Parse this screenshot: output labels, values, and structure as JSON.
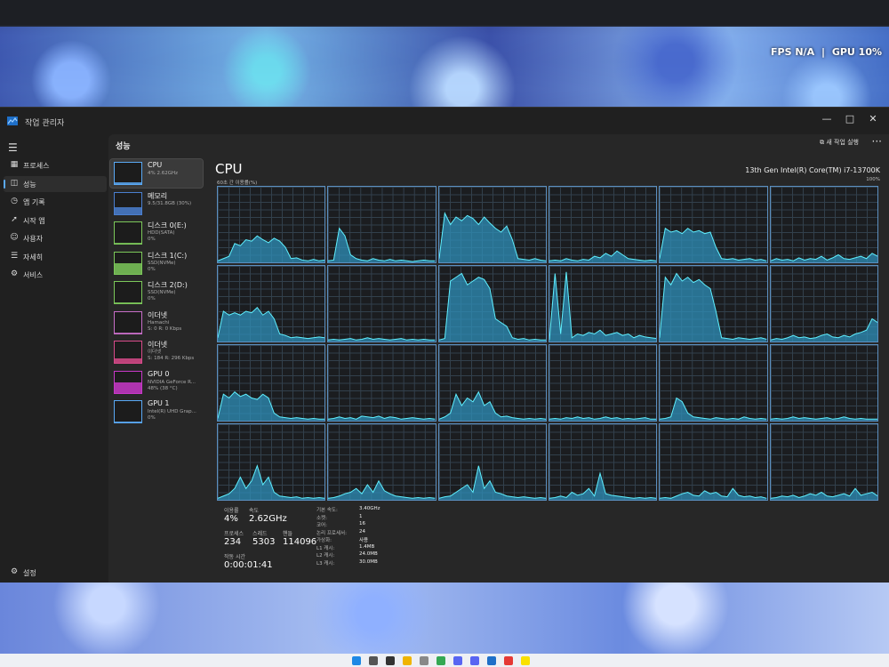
{
  "overlay": {
    "fps": "FPS N/A",
    "sep": "|",
    "gpu": "GPU 10%"
  },
  "window": {
    "title": "작업 관리자",
    "minimize": "—",
    "maximize": "□",
    "close": "✕"
  },
  "sidebar": {
    "items": [
      {
        "icon": "processes-icon",
        "glyph": "▦",
        "label": "프로세스",
        "active": false
      },
      {
        "icon": "performance-icon",
        "glyph": "◫",
        "label": "성능",
        "active": true
      },
      {
        "icon": "app-history-icon",
        "glyph": "◷",
        "label": "앱 기록",
        "active": false
      },
      {
        "icon": "startup-apps-icon",
        "glyph": "➚",
        "label": "시작 앱",
        "active": false
      },
      {
        "icon": "users-icon",
        "glyph": "☺",
        "label": "사용자",
        "active": false
      },
      {
        "icon": "details-icon",
        "glyph": "☰",
        "label": "자세히",
        "active": false
      },
      {
        "icon": "services-icon",
        "glyph": "⚙",
        "label": "서비스",
        "active": false
      }
    ],
    "settings_label": "설정"
  },
  "header": {
    "title": "성능",
    "run_task": "새 작업 실행",
    "more": "···"
  },
  "devices": [
    {
      "name": "CPU",
      "sub1": "4% 2.62GHz",
      "sub2": "",
      "color": "#5aa9f5",
      "level": 0.08
    },
    {
      "name": "메모리",
      "sub1": "9.5/31.8GB (30%)",
      "sub2": "",
      "color": "#4a7fd0",
      "level": 0.3
    },
    {
      "name": "디스크 0(E:)",
      "sub1": "HDD(SATA)",
      "sub2": "0%",
      "color": "#7cc85a",
      "level": 0.0
    },
    {
      "name": "디스크 1(C:)",
      "sub1": "SSD(NVMe)",
      "sub2": "0%",
      "color": "#7cc85a",
      "level": 0.5
    },
    {
      "name": "디스크 2(D:)",
      "sub1": "SSD(NVMe)",
      "sub2": "0%",
      "color": "#7cc85a",
      "level": 0.0
    },
    {
      "name": "이더넷",
      "sub1": "Hamachi",
      "sub2": "S: 0 R: 0 Kbps",
      "color": "#c86ec8",
      "level": 0.0
    },
    {
      "name": "이더넷",
      "sub1": "이더넷",
      "sub2": "S: 184 R: 296 Kbps",
      "color": "#d84a8a",
      "level": 0.2
    },
    {
      "name": "GPU 0",
      "sub1": "NVIDIA GeForce R...",
      "sub2": "48% (38 °C)",
      "color": "#c838c8",
      "level": 0.48
    },
    {
      "name": "GPU 1",
      "sub1": "Intel(R) UHD Grap...",
      "sub2": "0%",
      "color": "#5aa9f5",
      "level": 0.0
    }
  ],
  "detail": {
    "title": "CPU",
    "model": "13th Gen Intel(R) Core(TM) i7-13700K",
    "util_label": "60초 간 이용률(%)",
    "max_label": "100%"
  },
  "stats": {
    "util_label": "이용률",
    "util_value": "4%",
    "speed_label": "속도",
    "speed_value": "2.62GHz",
    "proc_label": "프로세스",
    "proc_value": "234",
    "thread_label": "스레드",
    "thread_value": "5303",
    "handle_label": "핸들",
    "handle_value": "114096",
    "uptime_label": "작동 시간",
    "uptime_value": "0:00:01:41",
    "specs": [
      {
        "k": "기본 속도:",
        "v": "3.40GHz"
      },
      {
        "k": "소켓:",
        "v": "1"
      },
      {
        "k": "코어:",
        "v": "16"
      },
      {
        "k": "논리 프로세서:",
        "v": "24"
      },
      {
        "k": "가상화:",
        "v": "사용"
      },
      {
        "k": "L1 캐시:",
        "v": "1.4MB"
      },
      {
        "k": "L2 캐시:",
        "v": "24.0MB"
      },
      {
        "k": "L3 캐시:",
        "v": "30.0MB"
      }
    ]
  },
  "core_activity": [
    [
      0.02,
      0.05,
      0.08,
      0.25,
      0.22,
      0.3,
      0.28,
      0.35,
      0.3,
      0.26,
      0.32,
      0.28,
      0.2,
      0.05,
      0.06,
      0.03,
      0.02,
      0.04,
      0.02,
      0.03
    ],
    [
      0.02,
      0.03,
      0.45,
      0.35,
      0.1,
      0.05,
      0.03,
      0.02,
      0.05,
      0.03,
      0.02,
      0.04,
      0.02,
      0.03,
      0.02,
      0.01,
      0.02,
      0.03,
      0.02,
      0.02
    ],
    [
      0.05,
      0.65,
      0.5,
      0.6,
      0.55,
      0.62,
      0.58,
      0.5,
      0.6,
      0.52,
      0.45,
      0.4,
      0.48,
      0.3,
      0.05,
      0.04,
      0.03,
      0.05,
      0.03,
      0.02
    ],
    [
      0.02,
      0.03,
      0.02,
      0.05,
      0.03,
      0.02,
      0.04,
      0.03,
      0.08,
      0.06,
      0.12,
      0.08,
      0.15,
      0.1,
      0.05,
      0.04,
      0.03,
      0.02,
      0.03,
      0.02
    ],
    [
      0.05,
      0.45,
      0.4,
      0.42,
      0.38,
      0.45,
      0.4,
      0.42,
      0.38,
      0.4,
      0.2,
      0.05,
      0.04,
      0.05,
      0.03,
      0.04,
      0.05,
      0.03,
      0.04,
      0.02
    ],
    [
      0.02,
      0.05,
      0.03,
      0.04,
      0.02,
      0.06,
      0.03,
      0.05,
      0.04,
      0.08,
      0.03,
      0.06,
      0.1,
      0.05,
      0.04,
      0.06,
      0.08,
      0.05,
      0.12,
      0.08
    ],
    [
      0.05,
      0.4,
      0.35,
      0.38,
      0.35,
      0.4,
      0.38,
      0.45,
      0.35,
      0.4,
      0.3,
      0.1,
      0.08,
      0.05,
      0.06,
      0.05,
      0.04,
      0.05,
      0.06,
      0.05
    ],
    [
      0.02,
      0.03,
      0.02,
      0.03,
      0.04,
      0.02,
      0.03,
      0.05,
      0.03,
      0.04,
      0.03,
      0.02,
      0.03,
      0.04,
      0.02,
      0.03,
      0.02,
      0.03,
      0.02,
      0.02
    ],
    [
      0.02,
      0.04,
      0.8,
      0.85,
      0.9,
      0.75,
      0.8,
      0.85,
      0.82,
      0.7,
      0.3,
      0.25,
      0.2,
      0.05,
      0.03,
      0.04,
      0.02,
      0.03,
      0.02,
      0.02
    ],
    [
      0.02,
      0.9,
      0.1,
      0.92,
      0.05,
      0.1,
      0.08,
      0.12,
      0.1,
      0.15,
      0.08,
      0.1,
      0.12,
      0.08,
      0.1,
      0.05,
      0.08,
      0.06,
      0.05,
      0.04
    ],
    [
      0.05,
      0.85,
      0.75,
      0.9,
      0.8,
      0.85,
      0.78,
      0.82,
      0.75,
      0.7,
      0.4,
      0.05,
      0.04,
      0.03,
      0.05,
      0.04,
      0.03,
      0.04,
      0.05,
      0.03
    ],
    [
      0.02,
      0.04,
      0.03,
      0.05,
      0.08,
      0.05,
      0.06,
      0.04,
      0.05,
      0.08,
      0.1,
      0.06,
      0.05,
      0.08,
      0.06,
      0.1,
      0.12,
      0.15,
      0.3,
      0.25
    ],
    [
      0.03,
      0.35,
      0.3,
      0.38,
      0.32,
      0.35,
      0.3,
      0.28,
      0.35,
      0.3,
      0.1,
      0.05,
      0.04,
      0.03,
      0.04,
      0.03,
      0.02,
      0.03,
      0.02,
      0.02
    ],
    [
      0.02,
      0.03,
      0.05,
      0.03,
      0.04,
      0.02,
      0.06,
      0.05,
      0.04,
      0.06,
      0.03,
      0.05,
      0.04,
      0.02,
      0.03,
      0.04,
      0.03,
      0.02,
      0.03,
      0.02
    ],
    [
      0.02,
      0.05,
      0.1,
      0.35,
      0.2,
      0.3,
      0.25,
      0.38,
      0.2,
      0.25,
      0.1,
      0.05,
      0.06,
      0.04,
      0.03,
      0.02,
      0.03,
      0.02,
      0.03,
      0.02
    ],
    [
      0.02,
      0.03,
      0.02,
      0.04,
      0.03,
      0.05,
      0.03,
      0.04,
      0.02,
      0.03,
      0.05,
      0.03,
      0.04,
      0.02,
      0.03,
      0.02,
      0.03,
      0.04,
      0.02,
      0.02
    ],
    [
      0.02,
      0.03,
      0.05,
      0.3,
      0.25,
      0.1,
      0.05,
      0.04,
      0.03,
      0.02,
      0.04,
      0.03,
      0.02,
      0.03,
      0.02,
      0.05,
      0.03,
      0.02,
      0.03,
      0.02
    ],
    [
      0.02,
      0.03,
      0.02,
      0.03,
      0.05,
      0.03,
      0.04,
      0.03,
      0.02,
      0.03,
      0.04,
      0.02,
      0.03,
      0.05,
      0.03,
      0.02,
      0.03,
      0.02,
      0.02,
      0.02
    ],
    [
      0.02,
      0.05,
      0.08,
      0.15,
      0.3,
      0.15,
      0.25,
      0.45,
      0.2,
      0.3,
      0.1,
      0.05,
      0.04,
      0.03,
      0.04,
      0.02,
      0.03,
      0.02,
      0.03,
      0.02
    ],
    [
      0.02,
      0.03,
      0.05,
      0.08,
      0.1,
      0.15,
      0.08,
      0.2,
      0.1,
      0.25,
      0.12,
      0.08,
      0.05,
      0.04,
      0.03,
      0.02,
      0.03,
      0.02,
      0.03,
      0.02
    ],
    [
      0.02,
      0.04,
      0.05,
      0.1,
      0.15,
      0.2,
      0.1,
      0.45,
      0.15,
      0.25,
      0.1,
      0.08,
      0.05,
      0.04,
      0.03,
      0.04,
      0.03,
      0.02,
      0.03,
      0.02
    ],
    [
      0.02,
      0.03,
      0.05,
      0.03,
      0.1,
      0.06,
      0.08,
      0.15,
      0.05,
      0.35,
      0.08,
      0.06,
      0.05,
      0.04,
      0.03,
      0.02,
      0.03,
      0.02,
      0.03,
      0.02
    ],
    [
      0.02,
      0.03,
      0.02,
      0.05,
      0.08,
      0.1,
      0.06,
      0.05,
      0.12,
      0.08,
      0.1,
      0.05,
      0.04,
      0.15,
      0.06,
      0.04,
      0.05,
      0.03,
      0.04,
      0.02
    ],
    [
      0.02,
      0.03,
      0.05,
      0.04,
      0.06,
      0.03,
      0.05,
      0.08,
      0.06,
      0.1,
      0.05,
      0.04,
      0.06,
      0.08,
      0.05,
      0.15,
      0.06,
      0.08,
      0.1,
      0.05
    ]
  ],
  "taskbar": {
    "icons": [
      "start-icon",
      "search-icon",
      "task-view-icon",
      "file-explorer-icon",
      "media-icon",
      "chrome-icon",
      "discord-icon",
      "discord-icon",
      "task-manager-icon",
      "app-icon",
      "kakaotalk-icon"
    ]
  }
}
